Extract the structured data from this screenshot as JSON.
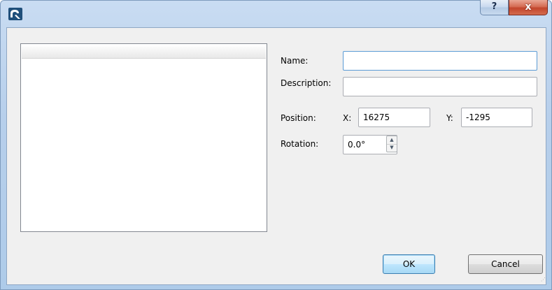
{
  "titlebar": {
    "icon": "app-logo-icon",
    "help_label": "?",
    "close_label": "x"
  },
  "form": {
    "name_label": "Name:",
    "name_value": "",
    "description_label": "Description:",
    "description_value": "",
    "position_label": "Position:",
    "x_label": "X:",
    "x_value": "16275",
    "y_label": "Y:",
    "y_value": "-1295",
    "rotation_label": "Rotation:",
    "rotation_value": "0.0°"
  },
  "buttons": {
    "ok_label": "OK",
    "cancel_label": "Cancel"
  },
  "colors": {
    "focus_border": "#5b9bd5",
    "close_red": "#c2452c"
  }
}
